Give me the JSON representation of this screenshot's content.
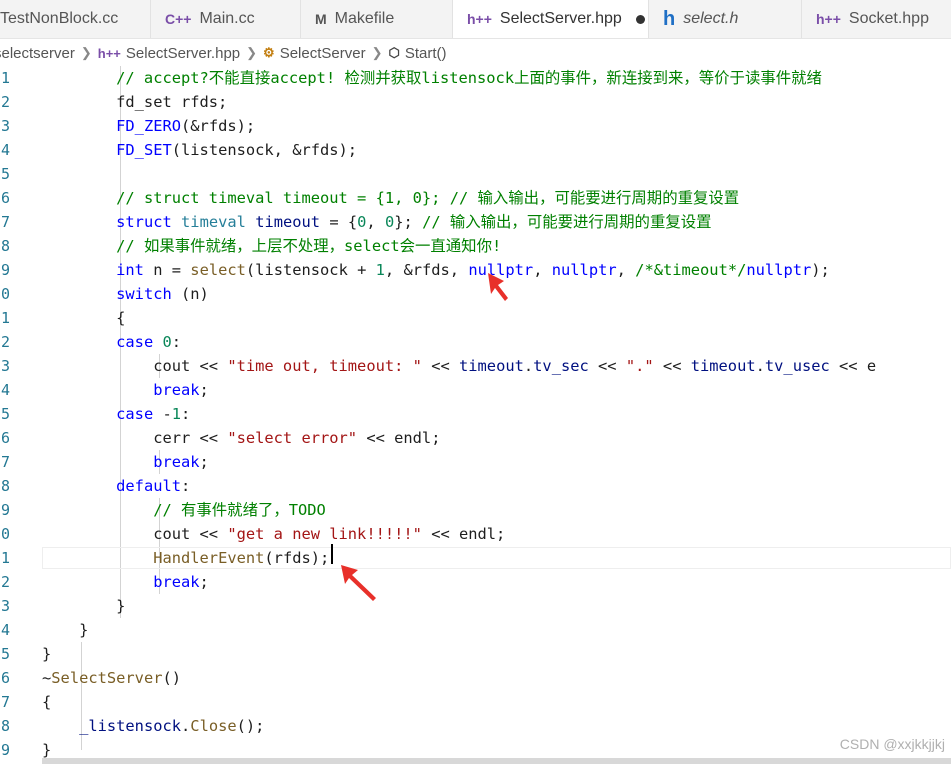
{
  "tabs": [
    {
      "label": "TestNonBlock.cc",
      "icon": "cpp-file-icon",
      "active": false
    },
    {
      "label": "Main.cc",
      "icon": "cpp-file-icon",
      "active": false
    },
    {
      "label": "Makefile",
      "icon": "makefile-icon",
      "active": false
    },
    {
      "label": "SelectServer.hpp",
      "icon": "hpp-file-icon",
      "active": true,
      "modified": true
    },
    {
      "label": "select.h",
      "icon": "h-file-icon",
      "active": false
    },
    {
      "label": "Socket.hpp",
      "icon": "hpp-file-icon",
      "active": false
    }
  ],
  "tab_icons": {
    "cpp": "C++",
    "hpp": "h++",
    "h": "h",
    "make": "M"
  },
  "breadcrumb": [
    {
      "label": "selectserver",
      "icon": "folder-icon"
    },
    {
      "label": "SelectServer.hpp",
      "icon": "hpp-file-icon"
    },
    {
      "label": "SelectServer",
      "icon": "class-icon"
    },
    {
      "label": "Start()",
      "icon": "method-icon"
    }
  ],
  "line_numbers": [
    "1",
    "2",
    "3",
    "4",
    "5",
    "6",
    "7",
    "8",
    "9",
    "0",
    "1",
    "2",
    "3",
    "4",
    "5",
    "6",
    "7",
    "8",
    "9",
    "0",
    "1",
    "2",
    "3",
    "4",
    "5",
    "6",
    "7",
    "8",
    "9"
  ],
  "code_lines": [
    [
      [
        "cm",
        "        // accept?不能直接accept! 检测并获取listensock上面的事件，新连接到来，等价于读事件就绪"
      ]
    ],
    [
      [
        "plain",
        "        fd_set rfds;"
      ]
    ],
    [
      [
        "plain",
        "        "
      ],
      [
        "mac",
        "FD_ZERO"
      ],
      [
        "plain",
        "(&rfds);"
      ]
    ],
    [
      [
        "plain",
        "        "
      ],
      [
        "mac",
        "FD_SET"
      ],
      [
        "plain",
        "(listensock, &rfds);"
      ]
    ],
    [
      [
        "plain",
        ""
      ]
    ],
    [
      [
        "plain",
        "        "
      ],
      [
        "cm",
        "// struct timeval timeout = {1, 0}; // 输入输出，可能要进行周期的重复设置"
      ]
    ],
    [
      [
        "plain",
        "        "
      ],
      [
        "k",
        "struct"
      ],
      [
        "plain",
        " "
      ],
      [
        "ty",
        "timeval"
      ],
      [
        "plain",
        " "
      ],
      [
        "vr",
        "timeout"
      ],
      [
        "plain",
        " = {"
      ],
      [
        "num",
        "0"
      ],
      [
        "plain",
        ", "
      ],
      [
        "num",
        "0"
      ],
      [
        "plain",
        "}; "
      ],
      [
        "cm",
        "// 输入输出，可能要进行周期的重复设置"
      ]
    ],
    [
      [
        "plain",
        "        "
      ],
      [
        "cm",
        "// 如果事件就绪，上层不处理，select会一直通知你!"
      ]
    ],
    [
      [
        "plain",
        "        "
      ],
      [
        "k",
        "int"
      ],
      [
        "plain",
        " n = "
      ],
      [
        "fn",
        "select"
      ],
      [
        "plain",
        "(listensock + "
      ],
      [
        "num",
        "1"
      ],
      [
        "plain",
        ", &rfds, "
      ],
      [
        "k",
        "nullptr"
      ],
      [
        "plain",
        ", "
      ],
      [
        "k",
        "nullptr"
      ],
      [
        "plain",
        ", "
      ],
      [
        "cm",
        "/*&timeout*/"
      ],
      [
        "k",
        "nullptr"
      ],
      [
        "plain",
        ");"
      ]
    ],
    [
      [
        "plain",
        "        "
      ],
      [
        "k",
        "switch"
      ],
      [
        "plain",
        " (n)"
      ]
    ],
    [
      [
        "plain",
        "        {"
      ]
    ],
    [
      [
        "plain",
        "        "
      ],
      [
        "k",
        "case"
      ],
      [
        "plain",
        " "
      ],
      [
        "num",
        "0"
      ],
      [
        "plain",
        ":"
      ]
    ],
    [
      [
        "plain",
        "            cout << "
      ],
      [
        "str",
        "\"time out, timeout: \""
      ],
      [
        "plain",
        " << "
      ],
      [
        "vr",
        "timeout"
      ],
      [
        "plain",
        "."
      ],
      [
        "vr",
        "tv_sec"
      ],
      [
        "plain",
        " << "
      ],
      [
        "str",
        "\".\""
      ],
      [
        "plain",
        " << "
      ],
      [
        "vr",
        "timeout"
      ],
      [
        "plain",
        "."
      ],
      [
        "vr",
        "tv_usec"
      ],
      [
        "plain",
        " << e"
      ]
    ],
    [
      [
        "plain",
        "            "
      ],
      [
        "k",
        "break"
      ],
      [
        "plain",
        ";"
      ]
    ],
    [
      [
        "plain",
        "        "
      ],
      [
        "k",
        "case"
      ],
      [
        "plain",
        " -"
      ],
      [
        "num",
        "1"
      ],
      [
        "plain",
        ":"
      ]
    ],
    [
      [
        "plain",
        "            cerr << "
      ],
      [
        "str",
        "\"select error\""
      ],
      [
        "plain",
        " << endl;"
      ]
    ],
    [
      [
        "plain",
        "            "
      ],
      [
        "k",
        "break"
      ],
      [
        "plain",
        ";"
      ]
    ],
    [
      [
        "plain",
        "        "
      ],
      [
        "k",
        "default"
      ],
      [
        "plain",
        ":"
      ]
    ],
    [
      [
        "plain",
        "            "
      ],
      [
        "cm",
        "// 有事件就绪了，TODO"
      ]
    ],
    [
      [
        "plain",
        "            cout << "
      ],
      [
        "str",
        "\"get a new link!!!!!\""
      ],
      [
        "plain",
        " << endl;"
      ]
    ],
    [
      [
        "plain",
        "            "
      ],
      [
        "fn",
        "HandlerEvent"
      ],
      [
        "plain",
        "(rfds);"
      ]
    ],
    [
      [
        "plain",
        "            "
      ],
      [
        "k",
        "break"
      ],
      [
        "plain",
        ";"
      ]
    ],
    [
      [
        "plain",
        "        }"
      ]
    ],
    [
      [
        "plain",
        "    }"
      ]
    ],
    [
      [
        "plain",
        "}"
      ]
    ],
    [
      [
        "plain",
        "~"
      ],
      [
        "fn",
        "SelectServer"
      ],
      [
        "plain",
        "()"
      ]
    ],
    [
      [
        "plain",
        "{"
      ]
    ],
    [
      [
        "plain",
        "    "
      ],
      [
        "vr",
        "_listensock"
      ],
      [
        "plain",
        "."
      ],
      [
        "fn",
        "Close"
      ],
      [
        "plain",
        "();"
      ]
    ],
    [
      [
        "plain",
        "}"
      ]
    ]
  ],
  "cursor_line_index": 20,
  "watermark": "CSDN @xxjkkjjkj",
  "colors": {
    "keyword": "#0000ff",
    "type": "#267f99",
    "function": "#795e26",
    "string": "#a31515",
    "number": "#098658",
    "comment": "#008000",
    "variable": "#001080",
    "line_number": "#237893",
    "annotation_arrow": "#e8302a"
  }
}
